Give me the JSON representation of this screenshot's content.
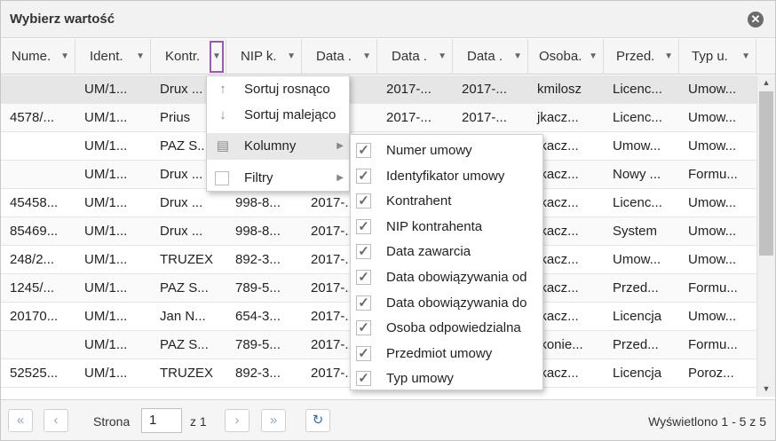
{
  "window": {
    "title": "Wybierz wartość",
    "close_icon": "close-icon"
  },
  "columns": [
    {
      "label": "Nume."
    },
    {
      "label": "Ident."
    },
    {
      "label": "Kontr."
    },
    {
      "label": "NIP k."
    },
    {
      "label": "Data ."
    },
    {
      "label": "Data ."
    },
    {
      "label": "Data ."
    },
    {
      "label": "Osoba."
    },
    {
      "label": "Przed."
    },
    {
      "label": "Typ u."
    }
  ],
  "rows": [
    [
      "",
      "UM/1...",
      "Drux ...",
      "",
      "",
      "2017-...",
      "2017-...",
      "kmilosz",
      "Licenc...",
      "Umow..."
    ],
    [
      "4578/...",
      "UM/1...",
      "Prius",
      "",
      "",
      "2017-...",
      "2017-...",
      "jkacz...",
      "Licenc...",
      "Umow..."
    ],
    [
      "",
      "UM/1...",
      "PAZ S...",
      "",
      "",
      "",
      "",
      "jkacz...",
      "Umow...",
      "Umow..."
    ],
    [
      "",
      "UM/1...",
      "Drux ...",
      "",
      "",
      "",
      "",
      "jkacz...",
      "Nowy ...",
      "Formu..."
    ],
    [
      "45458...",
      "UM/1...",
      "Drux ...",
      "998-8...",
      "2017-...",
      "",
      "",
      "jkacz...",
      "Licenc...",
      "Umow..."
    ],
    [
      "85469...",
      "UM/1...",
      "Drux ...",
      "998-8...",
      "2017-...",
      "",
      "",
      "jkacz...",
      "System",
      "Umow..."
    ],
    [
      "248/2...",
      "UM/1...",
      "TRUZEX",
      "892-3...",
      "2017-...",
      "",
      "",
      "jkacz...",
      "Umow...",
      "Umow..."
    ],
    [
      "1245/...",
      "UM/1...",
      "PAZ S...",
      "789-5...",
      "2017-...",
      "",
      "",
      "jkacz...",
      "Przed...",
      "Formu..."
    ],
    [
      "20170...",
      "UM/1...",
      "Jan N...",
      "654-3...",
      "2017-...",
      "",
      "",
      "jkacz...",
      "Licencja",
      "Umow..."
    ],
    [
      "",
      "UM/1...",
      "PAZ S...",
      "789-5...",
      "2017-...",
      "",
      "",
      "jkonie...",
      "Przed...",
      "Formu..."
    ],
    [
      "52525...",
      "UM/1...",
      "TRUZEX",
      "892-3...",
      "2017-...",
      "",
      "",
      "jkacz...",
      "Licencja",
      "Poroz..."
    ]
  ],
  "column_menu": {
    "sort_asc": "Sortuj rosnąco",
    "sort_desc": "Sortuj malejąco",
    "columns": "Kolumny",
    "filters": "Filtry"
  },
  "columns_submenu": [
    {
      "label": "Numer umowy",
      "checked": true
    },
    {
      "label": "Identyfikator umowy",
      "checked": true
    },
    {
      "label": "Kontrahent",
      "checked": true
    },
    {
      "label": "NIP kontrahenta",
      "checked": true
    },
    {
      "label": "Data zawarcia",
      "checked": true
    },
    {
      "label": "Data obowiązywania od",
      "checked": true
    },
    {
      "label": "Data obowiązywania do",
      "checked": true
    },
    {
      "label": "Osoba odpowiedzialna",
      "checked": true
    },
    {
      "label": "Przedmiot umowy",
      "checked": true
    },
    {
      "label": "Typ umowy",
      "checked": true
    }
  ],
  "pager": {
    "page_label": "Strona",
    "page_value": "1",
    "of_label": "z 1",
    "summary": "Wyświetlono 1 - 5 z 5"
  },
  "colors": {
    "accent": "#9b59b6",
    "refresh": "#2a6fb6"
  }
}
